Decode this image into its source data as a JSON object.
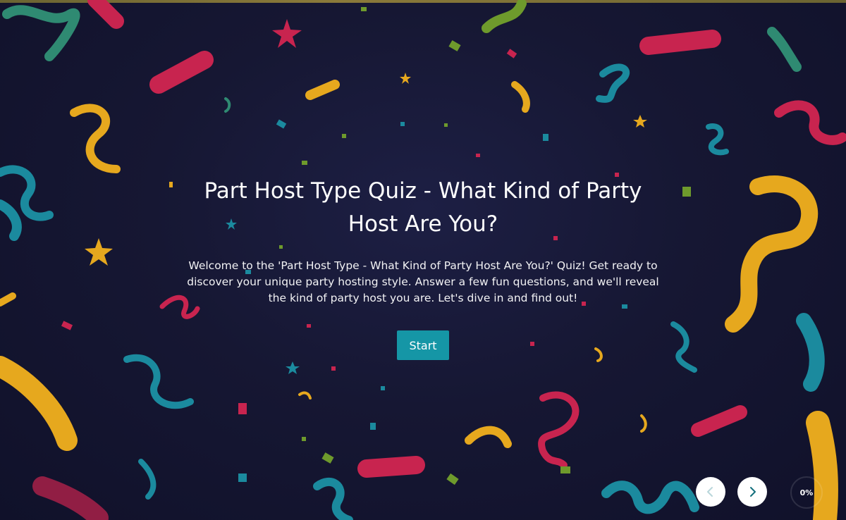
{
  "quiz": {
    "title": "Part Host Type Quiz - What Kind of Party Host Are You?",
    "description": "Welcome to the 'Part Host Type - What Kind of Party Host Are You?' Quiz! Get ready to discover your unique party hosting style. Answer a few fun questions, and we'll reveal the kind of party host you are. Let's dive in and find out!",
    "start_label": "Start"
  },
  "navigation": {
    "prev_icon": "chevron-left-icon",
    "next_icon": "chevron-right-icon",
    "progress_text": "0%",
    "progress_value": 0
  },
  "theme": {
    "background": "#151631",
    "accent": "#1596a6",
    "confetti_colors": [
      "#c8244f",
      "#e6a81e",
      "#1b8a9e",
      "#6e9a2c",
      "#2f8a72"
    ]
  }
}
